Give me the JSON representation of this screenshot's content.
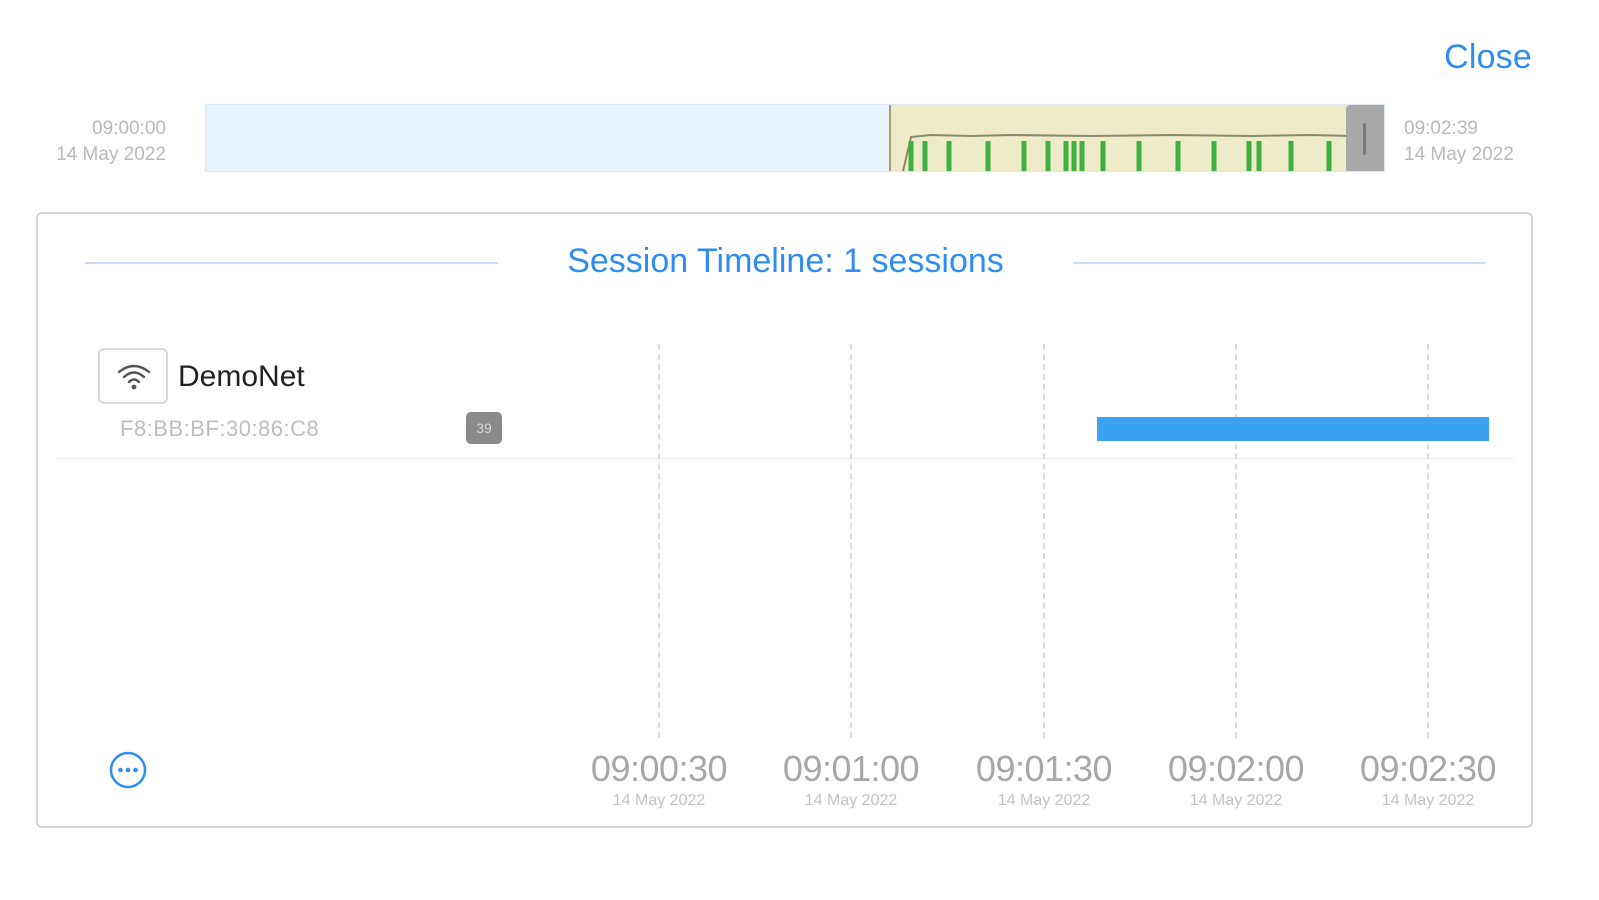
{
  "header": {
    "close_label": "Close"
  },
  "overview": {
    "start_time": "09:00:00",
    "start_date": "14 May 2022",
    "end_time": "09:02:39",
    "end_date": "14 May 2022",
    "selected_window_fraction": [
      0.58,
      1.0
    ]
  },
  "timeline": {
    "title": "Session Timeline: 1 sessions",
    "sessions": [
      {
        "name": "DemoNet",
        "mac": "F8:BB:BF:30:86:C8",
        "count": "39",
        "icon": "wifi-icon",
        "start": "09:01:37",
        "end": "09:02:39"
      }
    ],
    "ticks": [
      {
        "time": "09:00:30",
        "date": "14 May 2022"
      },
      {
        "time": "09:01:00",
        "date": "14 May 2022"
      },
      {
        "time": "09:01:30",
        "date": "14 May 2022"
      },
      {
        "time": "09:02:00",
        "date": "14 May 2022"
      },
      {
        "time": "09:02:30",
        "date": "14 May 2022"
      }
    ]
  },
  "colors": {
    "accent": "#2f8cf0",
    "session_bar": "#3aa2ee",
    "overview_window": "#edebc8",
    "overview_spikes": "#3fb03f"
  }
}
